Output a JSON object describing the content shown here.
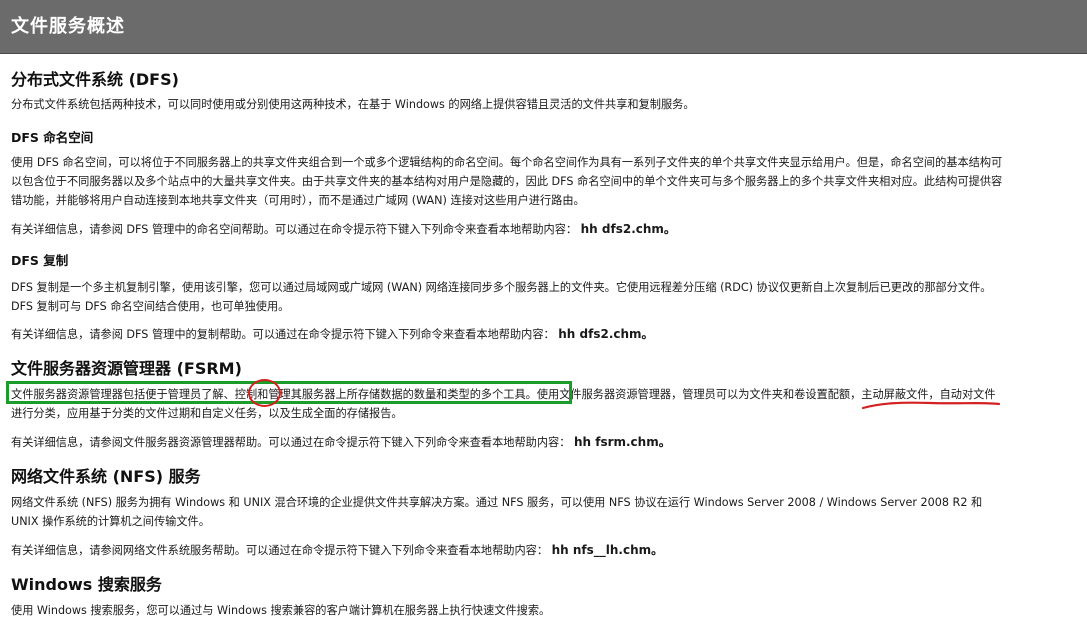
{
  "header": {
    "title": "文件服务概述"
  },
  "dfs": {
    "heading": "分布式文件系统 (DFS)",
    "intro": "分布式文件系统包括两种技术，可以同时使用或分别使用这两种技术，在基于 Windows 的网络上提供容错且灵活的文件共享和复制服务。",
    "namespace_heading": "DFS 命名空间",
    "namespace_p1_line1": "使用 DFS 命名空间，可以将位于不同服务器上的共享文件夹组合到一个或多个逻辑结构的命名空间。每个命名空间作为具有一系列子文件夹的单个共享文件夹显示给用户。但是，命名空间的基本结构可",
    "namespace_p1_line2": "以包含位于不同服务器以及多个站点中的大量共享文件夹。由于共享文件夹的基本结构对用户是隐藏的，因此 DFS 命名空间中的单个文件夹可与多个服务器上的多个共享文件夹相对应。此结构可提供容",
    "namespace_p1_line3": "错功能，并能够将用户自动连接到本地共享文件夹（可用时），而不是通过广域网 (WAN) 连接对这些用户进行路由。",
    "namespace_help": "有关详细信息，请参阅 DFS 管理中的命名空间帮助。可以通过在命令提示符下键入下列命令来查看本地帮助内容：",
    "namespace_cmd": "hh dfs2.chm。",
    "replication_heading": "DFS 复制",
    "replication_p1_line1": "DFS 复制是一个多主机复制引擎，使用该引擎，您可以通过局域网或广域网 (WAN) 网络连接同步多个服务器上的文件夹。它使用远程差分压缩 (RDC) 协议仅更新自上次复制后已更改的那部分文件。",
    "replication_p1_line2": "DFS 复制可与 DFS 命名空间结合使用，也可单独使用。",
    "replication_help": "有关详细信息，请参阅 DFS 管理中的复制帮助。可以通过在命令提示符下键入下列命令来查看本地帮助内容：",
    "replication_cmd": "hh dfs2.chm。"
  },
  "fsrm": {
    "heading": "文件服务器资源管理器 (FSRM)",
    "p1_line1": "文件服务器资源管理器包括便于管理员了解、控制和管理其服务器上所存储数据的数量和类型的多个工具。使用文件服务器资源管理器，管理员可以为文件夹和卷设置配额，主动屏蔽文件，自动对文件",
    "p1_line2": "进行分类，应用基于分类的文件过期和自定义任务，以及生成全面的存储报告。",
    "help": "有关详细信息，请参阅文件服务器资源管理器帮助。可以通过在命令提示符下键入下列命令来查看本地帮助内容：",
    "cmd": "hh fsrm.chm。"
  },
  "nfs": {
    "heading": "网络文件系统 (NFS) 服务",
    "p1_line1": "网络文件系统 (NFS) 服务为拥有 Windows 和 UNIX 混合环境的企业提供文件共享解决方案。通过 NFS 服务，可以使用 NFS 协议在运行 Windows Server 2008 / Windows Server 2008 R2 和",
    "p1_line2": "UNIX 操作系统的计算机之间传输文件。",
    "help": "有关详细信息，请参阅网络文件系统服务帮助。可以通过在命令提示符下键入下列命令来查看本地帮助内容：",
    "cmd": "hh nfs__lh.chm。"
  },
  "search": {
    "heading": "Windows 搜索服务",
    "p1": "使用 Windows 搜索服务，您可以通过与 Windows 搜索兼容的客户端计算机在服务器上执行快速文件搜索。"
  },
  "annotations": {
    "box_color": "#1c9c2a",
    "circle_color": "#d42020",
    "underline_color": "#d42020"
  }
}
